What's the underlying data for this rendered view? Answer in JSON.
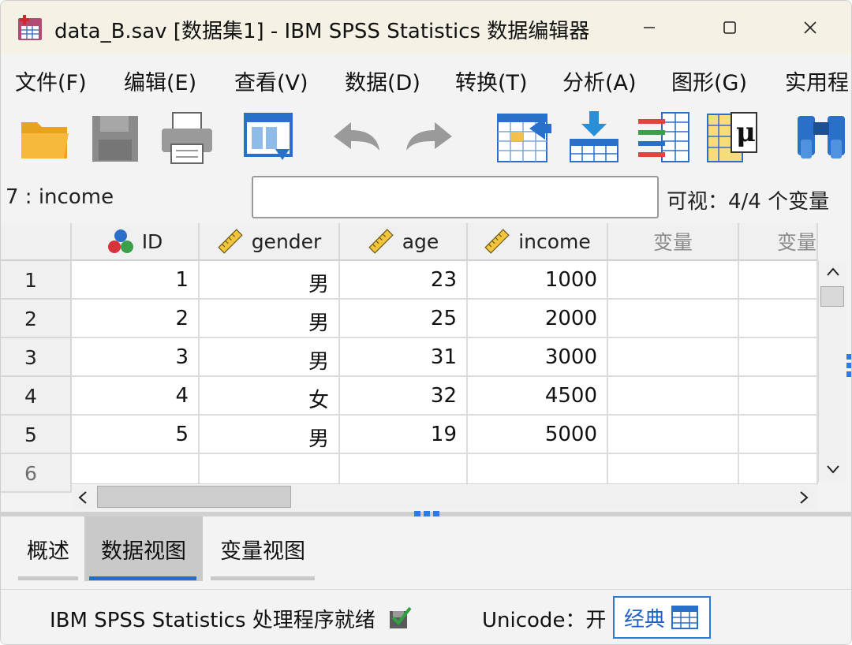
{
  "window": {
    "title": "data_B.sav [数据集1] - IBM SPSS Statistics 数据编辑器",
    "controls": {
      "minimize": "—",
      "maximize": "☐",
      "close": "✕"
    }
  },
  "menu": [
    "文件(F)",
    "编辑(E)",
    "查看(V)",
    "数据(D)",
    "转换(T)",
    "分析(A)",
    "图形(G)",
    "实用程"
  ],
  "toolbar": {
    "icons": [
      "open-folder-icon",
      "save-disk-icon",
      "printer-icon",
      "recall-dialog-icon",
      "undo-icon",
      "redo-icon",
      "goto-case-icon",
      "goto-variable-icon",
      "variables-icon",
      "value-labels-icon",
      "find-binoculars-icon"
    ]
  },
  "editor": {
    "cell_reference": "7 : income",
    "cell_value": "",
    "visible_info": "可视：4/4 个变量"
  },
  "grid": {
    "columns": [
      {
        "label": "ID",
        "icon": "nominal-icon"
      },
      {
        "label": "gender",
        "icon": "scale-ruler-icon"
      },
      {
        "label": "age",
        "icon": "scale-ruler-icon"
      },
      {
        "label": "income",
        "icon": "scale-ruler-icon"
      },
      {
        "label": "变量",
        "icon": ""
      },
      {
        "label": "变量",
        "icon": ""
      }
    ],
    "rows": [
      {
        "num": "1",
        "cells": [
          "1",
          "男",
          "23",
          "1000",
          "",
          ""
        ]
      },
      {
        "num": "2",
        "cells": [
          "2",
          "男",
          "25",
          "2000",
          "",
          ""
        ]
      },
      {
        "num": "3",
        "cells": [
          "3",
          "男",
          "31",
          "3000",
          "",
          ""
        ]
      },
      {
        "num": "4",
        "cells": [
          "4",
          "女",
          "32",
          "4500",
          "",
          ""
        ]
      },
      {
        "num": "5",
        "cells": [
          "5",
          "男",
          "19",
          "5000",
          "",
          ""
        ]
      },
      {
        "num": "6",
        "cells": [
          "",
          "",
          "",
          "",
          "",
          ""
        ]
      }
    ]
  },
  "tabs": [
    "概述",
    "数据视图",
    "变量视图"
  ],
  "active_tab": "数据视图",
  "status": {
    "processor": "IBM SPSS Statistics 处理程序就绪",
    "unicode": "Unicode：开",
    "mode_button": "经典"
  },
  "colors": {
    "accent": "#2e7bd6",
    "titlebar": "#f5f1e4",
    "tab_underline": "#1f6fd0"
  }
}
